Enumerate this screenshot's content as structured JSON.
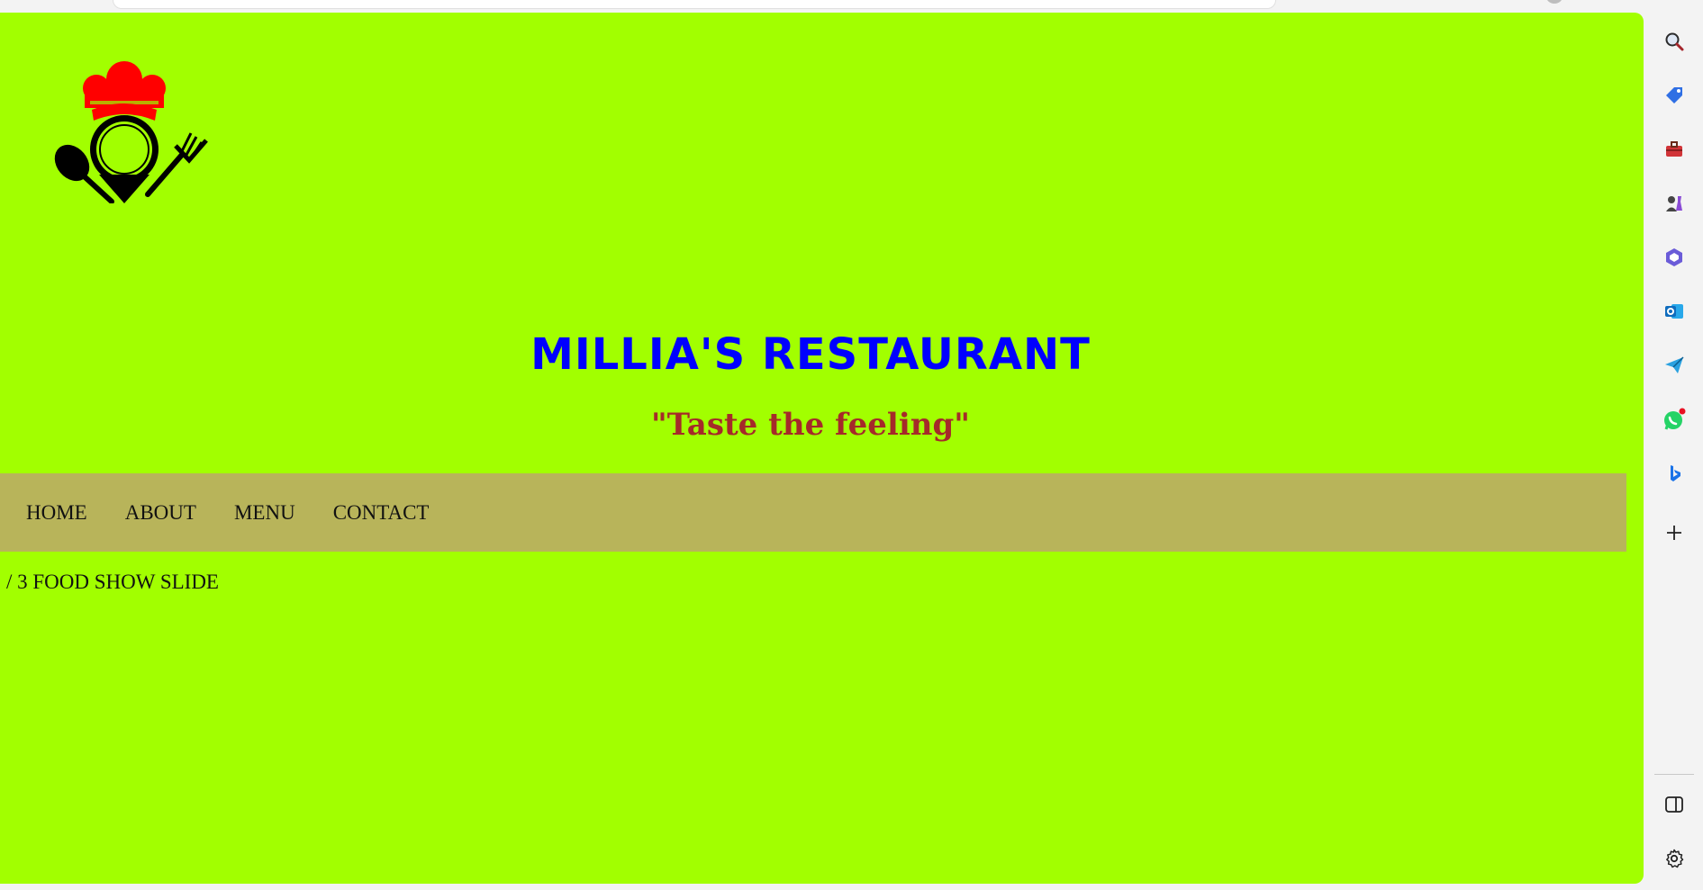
{
  "page": {
    "background_color": "#a2ff00"
  },
  "header": {
    "title": "MILLIA'S RESTAURANT",
    "tagline": "\"Taste the feeling\"",
    "title_color": "#0000ff",
    "tagline_color": "#a52a2a"
  },
  "nav": {
    "background_color": "#b8b45a",
    "items": [
      {
        "label": "HOME"
      },
      {
        "label": "ABOUT"
      },
      {
        "label": "MENU"
      },
      {
        "label": "CONTACT"
      }
    ]
  },
  "slideshow": {
    "caption": "/ 3 FOOD SHOW SLIDE"
  },
  "browser_sidebar": {
    "icons": [
      "search-icon",
      "shopping-tag-icon",
      "toolbox-icon",
      "games-icon",
      "microsoft365-icon",
      "outlook-icon",
      "send-icon",
      "whatsapp-icon",
      "bing-icon",
      "add-icon",
      "split-screen-icon",
      "settings-icon"
    ]
  }
}
